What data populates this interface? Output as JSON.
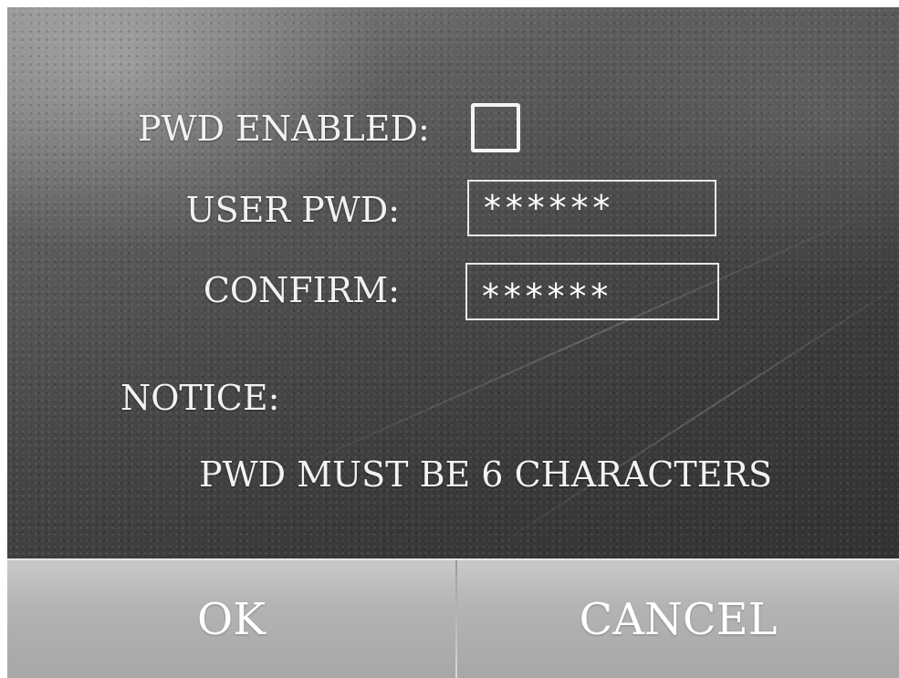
{
  "form": {
    "pwd_enabled_label": "PWD ENABLED:",
    "pwd_enabled_checked": false,
    "user_pwd_label": "USER PWD:",
    "user_pwd_value": "******",
    "confirm_label": "CONFIRM:",
    "confirm_value": "******"
  },
  "notice": {
    "heading": "NOTICE:",
    "text": "PWD MUST BE 6 CHARACTERS"
  },
  "buttons": {
    "ok_label": "OK",
    "cancel_label": "CANCEL"
  },
  "colors": {
    "text": "#f2f2f2",
    "button_bar": "#b3b3b3"
  }
}
